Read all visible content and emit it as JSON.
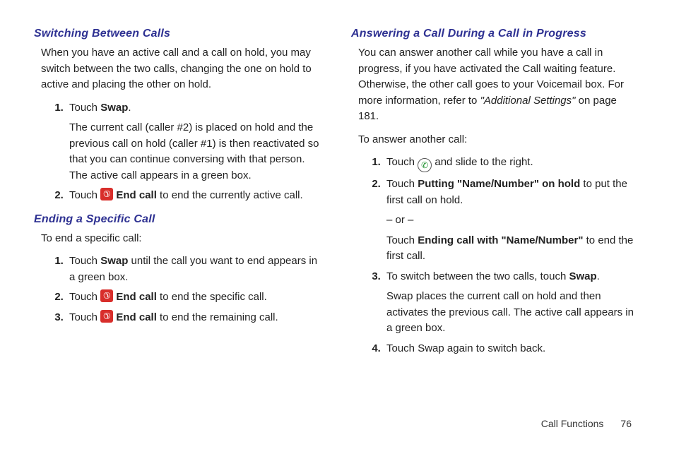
{
  "left": {
    "section1": {
      "heading": "Switching Between Calls",
      "intro": "When you have an active call and a call on hold, you may switch between the two calls, changing the one on hold to active and placing the other on hold.",
      "step1_pre": "Touch ",
      "step1_bold": "Swap",
      "step1_post": ".",
      "step1_sub": "The current call (caller #2) is placed on hold and the previous call on hold (caller #1) is then reactivated so that you can continue conversing with that person. The active call appears in a green box.",
      "step2_pre": "Touch ",
      "step2_bold": " End call",
      "step2_post": " to end the currently active call."
    },
    "section2": {
      "heading": "Ending a Specific Call",
      "intro": "To end a specific call:",
      "step1_pre": "Touch ",
      "step1_bold": "Swap",
      "step1_post": " until the call you want to end appears in a green box.",
      "step2_pre": "Touch ",
      "step2_bold": " End call",
      "step2_post": " to end the specific call.",
      "step3_pre": "Touch ",
      "step3_bold": " End call",
      "step3_post": " to end the remaining call."
    }
  },
  "right": {
    "heading": "Answering a Call During a Call in Progress",
    "intro_pre": "You can answer another call while you have a call in progress, if you have activated the Call waiting feature. Otherwise, the other call goes to your Voicemail box. For more information, refer to ",
    "intro_ref": "\"Additional Settings\"",
    "intro_post": " on page 181.",
    "lead": "To answer another call:",
    "step1_pre": "Touch ",
    "step1_post": " and slide to the right.",
    "step2_pre": "Touch ",
    "step2_bold": "Putting \"Name/Number\" on hold",
    "step2_post": " to put the first call on hold.",
    "step2_or": "– or –",
    "step2b_pre": "Touch ",
    "step2b_bold": "Ending call with \"Name/Number\"",
    "step2b_post": " to end the first call.",
    "step3_pre": "To switch between the two calls, touch ",
    "step3_bold": "Swap",
    "step3_post": ".",
    "step3_sub": "Swap places the current call on hold and then activates the previous call. The active call appears in a green box.",
    "step4": "Touch Swap again to switch back."
  },
  "footer": {
    "section": "Call Functions",
    "page": "76"
  },
  "icons": {
    "endcall": "end-call-icon",
    "answer": "answer-call-icon"
  }
}
